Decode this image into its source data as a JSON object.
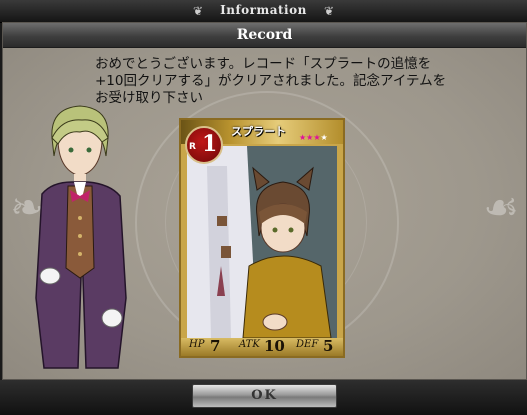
{
  "header": {
    "title": "Information"
  },
  "section": {
    "title": "Record"
  },
  "message": {
    "line1": "おめでとうございます。レコード「スプラートの追憶を",
    "line2": "+10回クリアする」がクリアされました。記念アイテムを",
    "line3": "お受け取り下さい"
  },
  "card": {
    "name": "スプラート",
    "rank_letter": "R",
    "rank_number": "1",
    "stars": "★★★★",
    "star_colors": [
      "#e0119a",
      "#e0119a",
      "#e0119a",
      "#ffffff"
    ],
    "hp_label": "HP",
    "hp_value": "7",
    "atk_label": "ATK",
    "atk_value": "10",
    "def_label": "DEF",
    "def_value": "5"
  },
  "buttons": {
    "ok_label": "OK"
  }
}
